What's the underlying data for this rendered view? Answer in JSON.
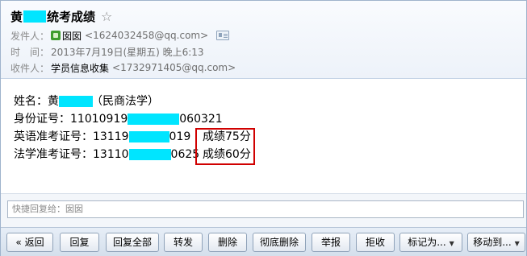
{
  "header": {
    "subject_prefix": "黄",
    "subject_suffix": "统考成绩",
    "star_icon": "☆",
    "from_label": "发件人：",
    "from_name": "囡囡",
    "from_email": "<1624032458@qq.com>",
    "time_label": "时　间：",
    "time_value": "2013年7月19日(星期五) 晚上6:13",
    "to_label": "收件人：",
    "to_name": "学员信息收集",
    "to_email": "<1732971405@qq.com>"
  },
  "body": {
    "name_label": "姓名：",
    "name_prefix": "黄",
    "name_suffix": "（民商法学）",
    "id_label": "身份证号：",
    "id_prefix": "11010919",
    "id_suffix": "060321",
    "english_label": "英语准考证号：",
    "english_prefix": "13119",
    "english_suffix": "019",
    "english_score": "成绩75分",
    "law_label": "法学准考证号：",
    "law_prefix": "13110",
    "law_suffix": "0625",
    "law_score": "成绩60分"
  },
  "quick_reply": {
    "placeholder": "快捷回复给：囡囡"
  },
  "toolbar": {
    "back": "« 返回",
    "reply": "回复",
    "reply_all": "回复全部",
    "forward": "转发",
    "delete": "删除",
    "delete_permanently": "彻底删除",
    "report": "举报",
    "reject": "拒收",
    "mark_as": "标记为...",
    "move_to": "移动到..."
  },
  "colors": {
    "redaction": "#00e5ff",
    "highlight_box": "#d00000"
  }
}
